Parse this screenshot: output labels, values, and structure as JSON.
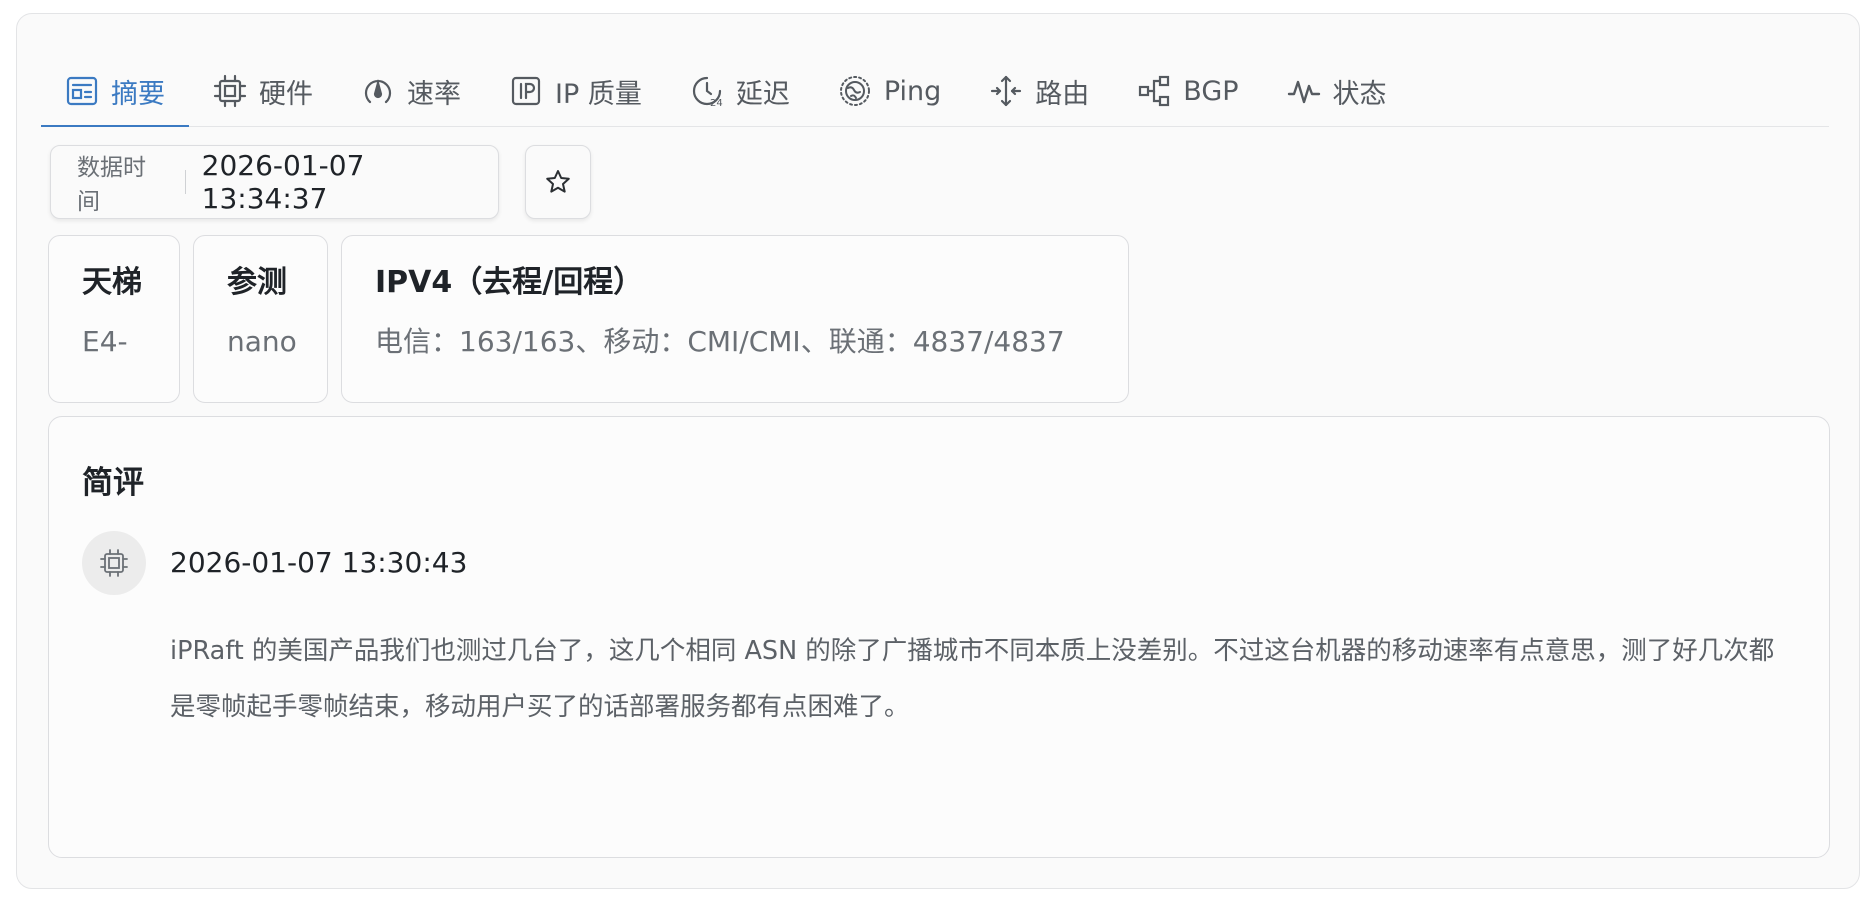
{
  "tabs": [
    {
      "label": "摘要",
      "icon": "summary-icon",
      "active": true
    },
    {
      "label": "硬件",
      "icon": "chip-icon",
      "active": false
    },
    {
      "label": "速率",
      "icon": "speed-icon",
      "active": false
    },
    {
      "label": "IP 质量",
      "icon": "ip-icon",
      "active": false
    },
    {
      "label": "延迟",
      "icon": "latency-icon",
      "active": false
    },
    {
      "label": "Ping",
      "icon": "globe-icon",
      "active": false
    },
    {
      "label": "路由",
      "icon": "route-icon",
      "active": false
    },
    {
      "label": "BGP",
      "icon": "bgp-icon",
      "active": false
    },
    {
      "label": "状态",
      "icon": "status-icon",
      "active": false
    }
  ],
  "data_time": {
    "label": "数据时间",
    "value": "2026-01-07 13:34:37"
  },
  "favorite": {
    "icon": "star-icon"
  },
  "cards": {
    "ladder": {
      "title": "天梯",
      "value": "E4-"
    },
    "participant": {
      "title": "参测",
      "value": "nano"
    },
    "ipv4": {
      "title": "IPV4（去程/回程）",
      "value": "电信：163/163、移动：CMI/CMI、联通：4837/4837"
    }
  },
  "review": {
    "title": "简评",
    "avatar_icon": "chip-icon",
    "time": "2026-01-07 13:30:43",
    "text": "iPRaft 的美国产品我们也测过几台了，这几个相同 ASN 的除了广播城市不同本质上没差别。不过这台机器的移动速率有点意思，测了好几次都是零帧起手零帧结束，移动用户买了的话部署服务都有点困难了。"
  },
  "colors": {
    "accent": "#3b7ac2",
    "text": "#1f2328",
    "muted": "#6b7076"
  }
}
